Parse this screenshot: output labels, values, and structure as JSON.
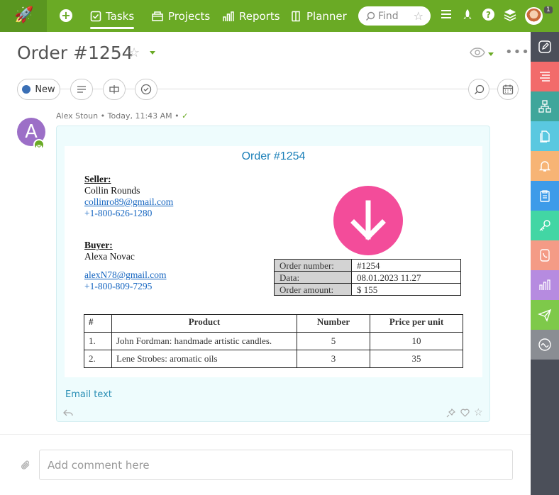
{
  "topbar": {
    "nav": {
      "tasks": "Tasks",
      "projects": "Projects",
      "reports": "Reports",
      "planner": "Planner"
    },
    "search_placeholder": "Find",
    "notification_count": "1",
    "accent_color": "#6aaa25"
  },
  "header": {
    "title": "Order #1254"
  },
  "toolbar": {
    "status_label": "New",
    "status_color": "#3a6fb5"
  },
  "message": {
    "avatar_letter": "A",
    "author": "Alex Stoun",
    "timestamp": "Today, 11:43 AM",
    "email_text_label": "Email text",
    "document": {
      "title": "Order #1254",
      "seller_heading": "Seller:",
      "seller_name": "Collin Rounds",
      "seller_email": "collinro89@gmail.com",
      "seller_phone": "+1-800-626-1280",
      "buyer_heading": "Buyer:",
      "buyer_name": "Alexa Novac",
      "buyer_email": "alexN78@gmail.com",
      "buyer_phone": "+1-800-809-7295",
      "info": [
        {
          "key": "Order number:",
          "value": "#1254"
        },
        {
          "key": "Data:",
          "value": "08.01.2023 11.27"
        },
        {
          "key": "Order amount:",
          "value": "$ 155"
        }
      ],
      "products": {
        "headers": [
          "#",
          "Product",
          "Number",
          "Price per unit"
        ],
        "rows": [
          [
            "1.",
            "John Fordman: handmade artistic candles.",
            "5",
            "10"
          ],
          [
            "2.",
            "Lene Strobes: aromatic oils",
            "3",
            "35"
          ]
        ]
      }
    }
  },
  "comment": {
    "placeholder": "Add comment here"
  },
  "rail_colors": [
    "#4b4f59",
    "#f26b6b",
    "#3fa69b",
    "#5ac8e0",
    "#f7b475",
    "#3d9be9",
    "#42d6a4",
    "#f49b86",
    "#b68be0",
    "#7ec94a",
    "#8a8d93"
  ]
}
